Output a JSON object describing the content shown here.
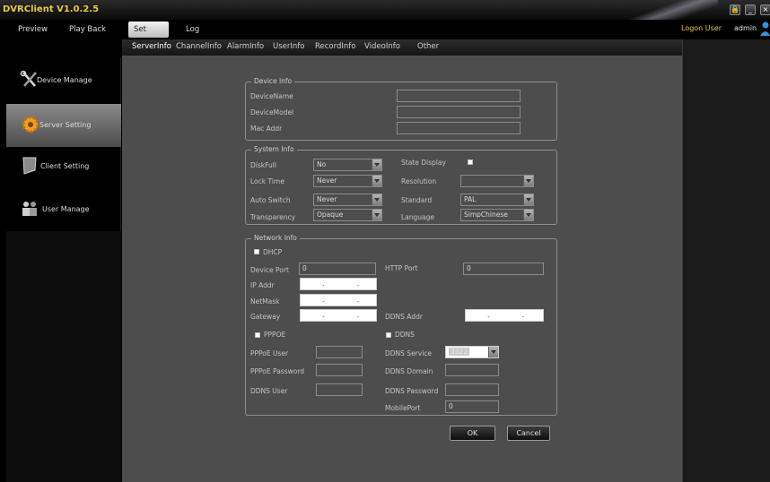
{
  "app": {
    "title": "DVRClient V1.0.2.5"
  },
  "window_controls": {
    "lock": "🔒",
    "minimize": "_",
    "close": "×"
  },
  "menu": {
    "preview": "Preview",
    "playback": "Play Back",
    "set": "Set",
    "log": "Log"
  },
  "session": {
    "logon_label": "Logon User",
    "user": "admin"
  },
  "sidebar": {
    "items": [
      {
        "label": "Device Manage",
        "icon": "tools-icon"
      },
      {
        "label": "Server Setting",
        "icon": "gear-icon",
        "active": true
      },
      {
        "label": "Client Setting",
        "icon": "monitor-icon"
      },
      {
        "label": "User Manage",
        "icon": "users-icon"
      }
    ]
  },
  "subtabs": [
    "ServerInfo",
    "ChannelInfo",
    "AlarmInfo",
    "UserInfo",
    "RecordInfo",
    "VideoInfo",
    "Other"
  ],
  "device_info": {
    "title": "Device Info",
    "device_name_label": "DeviceName",
    "device_name": "",
    "device_model_label": "DeviceModel",
    "device_model": "",
    "mac_label": "Mac Addr",
    "mac": ""
  },
  "system_info": {
    "title": "System Info",
    "diskfull_label": "DiskFull",
    "diskfull": "No",
    "lock_time_label": "Lock Time",
    "lock_time": "Never",
    "auto_switch_label": "Auto Switch",
    "auto_switch": "Never",
    "transparency_label": "Transparency",
    "transparency": "Opaque",
    "state_display_label": "State Display",
    "resolution_label": "Resolution",
    "resolution": "",
    "standard_label": "Standard",
    "standard": "PAL",
    "language_label": "Language",
    "language": "SimpChinese"
  },
  "network_info": {
    "title": "Network Info",
    "dhcp_label": "DHCP",
    "device_port_label": "Device Port",
    "device_port": "0",
    "http_port_label": "HTTP Port",
    "http_port": "0",
    "ip_label": "IP Addr",
    "netmask_label": "NetMask",
    "gateway_label": "Gateway",
    "ip_mask": ". . .",
    "ddns_addr_label": "DDNS Addr",
    "pppoe_label": "PPPOE",
    "ddns_label": "DDNS",
    "pppoe_user_label": "PPPoE User",
    "pppoe_user": "",
    "pppoe_password_label": "PPPoE Password",
    "pppoe_password": "",
    "ddns_user_label": "DDNS User",
    "ddns_user": "",
    "ddns_service_label": "DDNS Service",
    "ddns_service": "3322",
    "ddns_domain_label": "DDNS Domain",
    "ddns_domain": "",
    "ddns_password_label": "DDNS Password",
    "ddns_password": "",
    "mobile_port_label": "MobilePort",
    "mobile_port": "0"
  },
  "buttons": {
    "ok": "OK",
    "cancel": "Cancel"
  }
}
